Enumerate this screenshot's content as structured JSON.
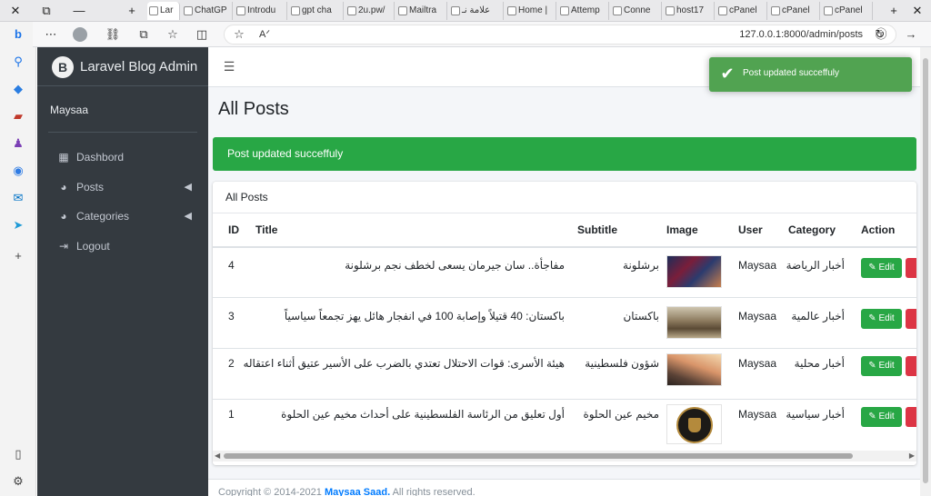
{
  "browser": {
    "tabs": [
      {
        "label": "Lar",
        "active": true
      },
      {
        "label": "ChatGP"
      },
      {
        "label": "Introdu"
      },
      {
        "label": "gpt cha"
      },
      {
        "label": "2u.pw/"
      },
      {
        "label": "Mailtra"
      },
      {
        "label": "علامة نـ"
      },
      {
        "label": "Home |"
      },
      {
        "label": "Attemp"
      },
      {
        "label": "Conne"
      },
      {
        "label": "host17"
      },
      {
        "label": "cPanel"
      },
      {
        "label": "cPanel"
      },
      {
        "label": "cPanel"
      }
    ],
    "url": "127.0.0.1:8000/admin/posts"
  },
  "sidebar": {
    "brand": "Laravel Blog Admin",
    "brand_logo_letter": "B",
    "user": "Maysaa",
    "items": [
      {
        "label": "Dashbord",
        "icon": "dashboard-icon"
      },
      {
        "label": "Posts",
        "icon": "palette-icon",
        "has_arrow": true
      },
      {
        "label": "Categories",
        "icon": "palette-icon",
        "has_arrow": true
      },
      {
        "label": "Logout",
        "icon": "logout-icon"
      }
    ]
  },
  "main": {
    "page_title": "All Posts",
    "alert": "Post updated succeffuly",
    "card_title": "All Posts",
    "edit_label": "Edit",
    "columns": [
      "ID",
      "Title",
      "Subtitle",
      "Image",
      "User",
      "Category",
      "Action"
    ],
    "rows": [
      {
        "id": "4",
        "title": "مفاجأة.. سان جيرمان يسعى لخطف نجم برشلونة",
        "subtitle": "برشلونة",
        "user": "Maysaa",
        "category": "أخبار الرياضة"
      },
      {
        "id": "3",
        "title": "باكستان: 40 قتيلاً وإصابة 100 في انفجار هائل يهز تجمعاً سياسياً",
        "subtitle": "باكستان",
        "user": "Maysaa",
        "category": "أخبار عالمية"
      },
      {
        "id": "2",
        "title": "هيئة الأسرى: قوات الاحتلال تعتدي بالضرب على الأسير عتيق أثناء اعتقاله",
        "subtitle": "شؤون فلسطينية",
        "user": "Maysaa",
        "category": "أخبار محلية"
      },
      {
        "id": "1",
        "title": "أول تعليق من الرئاسة الفلسطينية على أحداث مخيم عين الحلوة",
        "subtitle": "مخيم عين الحلوة",
        "user": "Maysaa",
        "category": "أخبار سياسية"
      }
    ]
  },
  "footer": {
    "prefix": "Copyright © 2014-2021 ",
    "author": "Maysaa Saad.",
    "suffix": " All rights reserved."
  },
  "toast": {
    "message": "Post updated succeffuly"
  },
  "colors": {
    "sidebar_bg": "#343a40",
    "success": "#28a745",
    "danger": "#dc3545",
    "toast_bg": "#51a351",
    "link": "#007bff"
  }
}
